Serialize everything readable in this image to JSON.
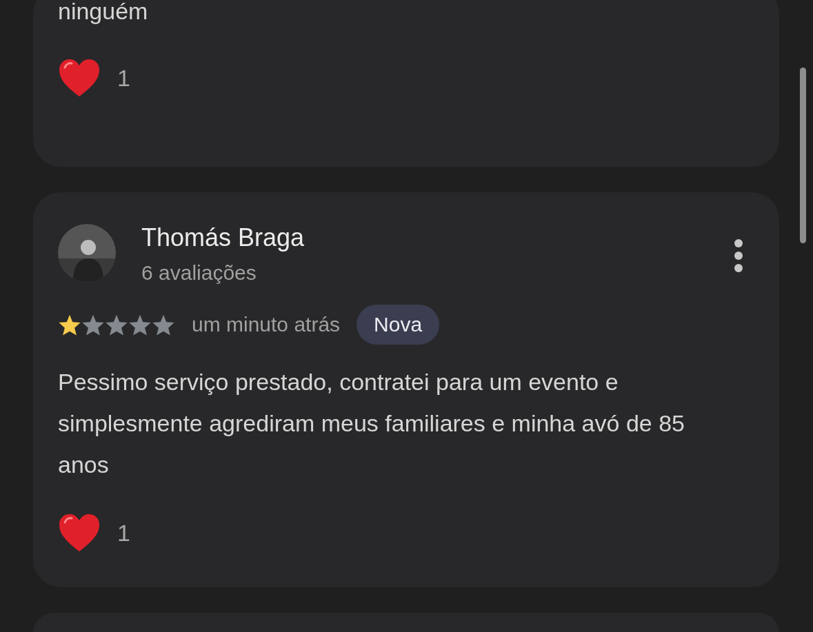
{
  "reviews": [
    {
      "kind": "partial",
      "text": "ninguém",
      "reactions": "1"
    },
    {
      "kind": "full",
      "author": "Thomás Braga",
      "review_count": "6 avaliações",
      "stars": 1,
      "time": "um minuto atrás",
      "badge": "Nova",
      "text": "Pessimo serviço prestado, contratei para um evento e simplesmente agrediram meus familiares e minha avó de 85 anos",
      "reactions": "1"
    },
    {
      "kind": "peek"
    }
  ]
}
